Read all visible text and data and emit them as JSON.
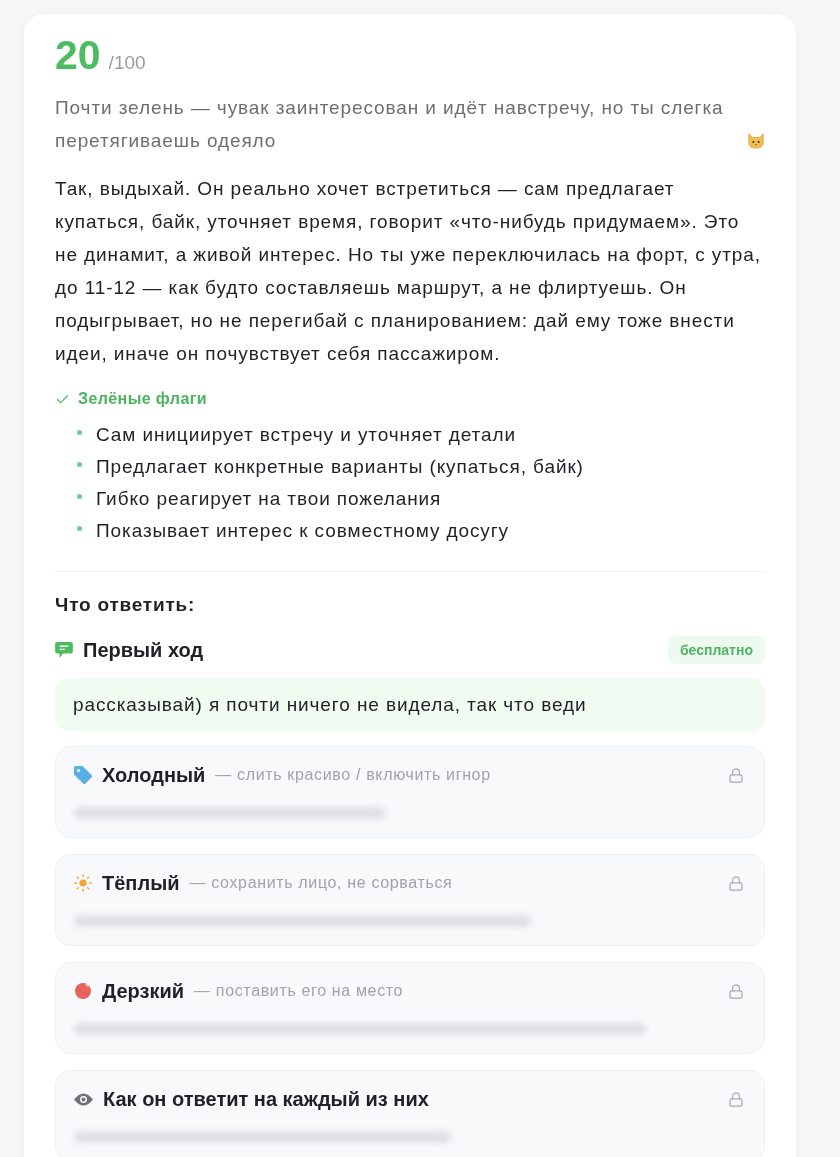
{
  "score": {
    "value": "20",
    "max": "/100"
  },
  "verdict": "Почти зелень — чувак заинтересован и идёт навстречу, но ты слегка перетягиваешь одеяло",
  "analysis": "Так, выдыхай. Он реально хочет встретиться — сам предлагает купаться, байк, уточняет время, говорит «что-нибудь придумаем». Это не динамит, а живой интерес. Но ты уже переключилась на форт, с утра, до 11-12 — как будто составляешь маршрут, а не флиртуешь. Он подыгрывает, но не перегибай с планированием: дай ему тоже внести идеи, иначе он почувствует себя пассажиром.",
  "green_flags": {
    "title": "Зелёные флаги",
    "items": [
      "Сам инициирует встречу и уточняет детали",
      "Предлагает конкретные варианты (купаться, байк)",
      "Гибко реагирует на твои пожелания",
      "Показывает интерес к совместному досугу"
    ]
  },
  "reply_section": {
    "title": "Что ответить:",
    "first_move": {
      "title": "Первый ход",
      "badge": "бесплатно",
      "text": "рассказывай) я почти ничего не видела, так что веди"
    },
    "options": [
      {
        "title": "Холодный",
        "subtitle": "— слить красиво / включить игнор",
        "locked": true
      },
      {
        "title": "Тёплый",
        "subtitle": "— сохранить лицо, не сорваться",
        "locked": true
      },
      {
        "title": "Дерзкий",
        "subtitle": "— поставить его на место",
        "locked": true
      },
      {
        "title": "Как он ответит на каждый из них",
        "locked": true
      }
    ]
  }
}
